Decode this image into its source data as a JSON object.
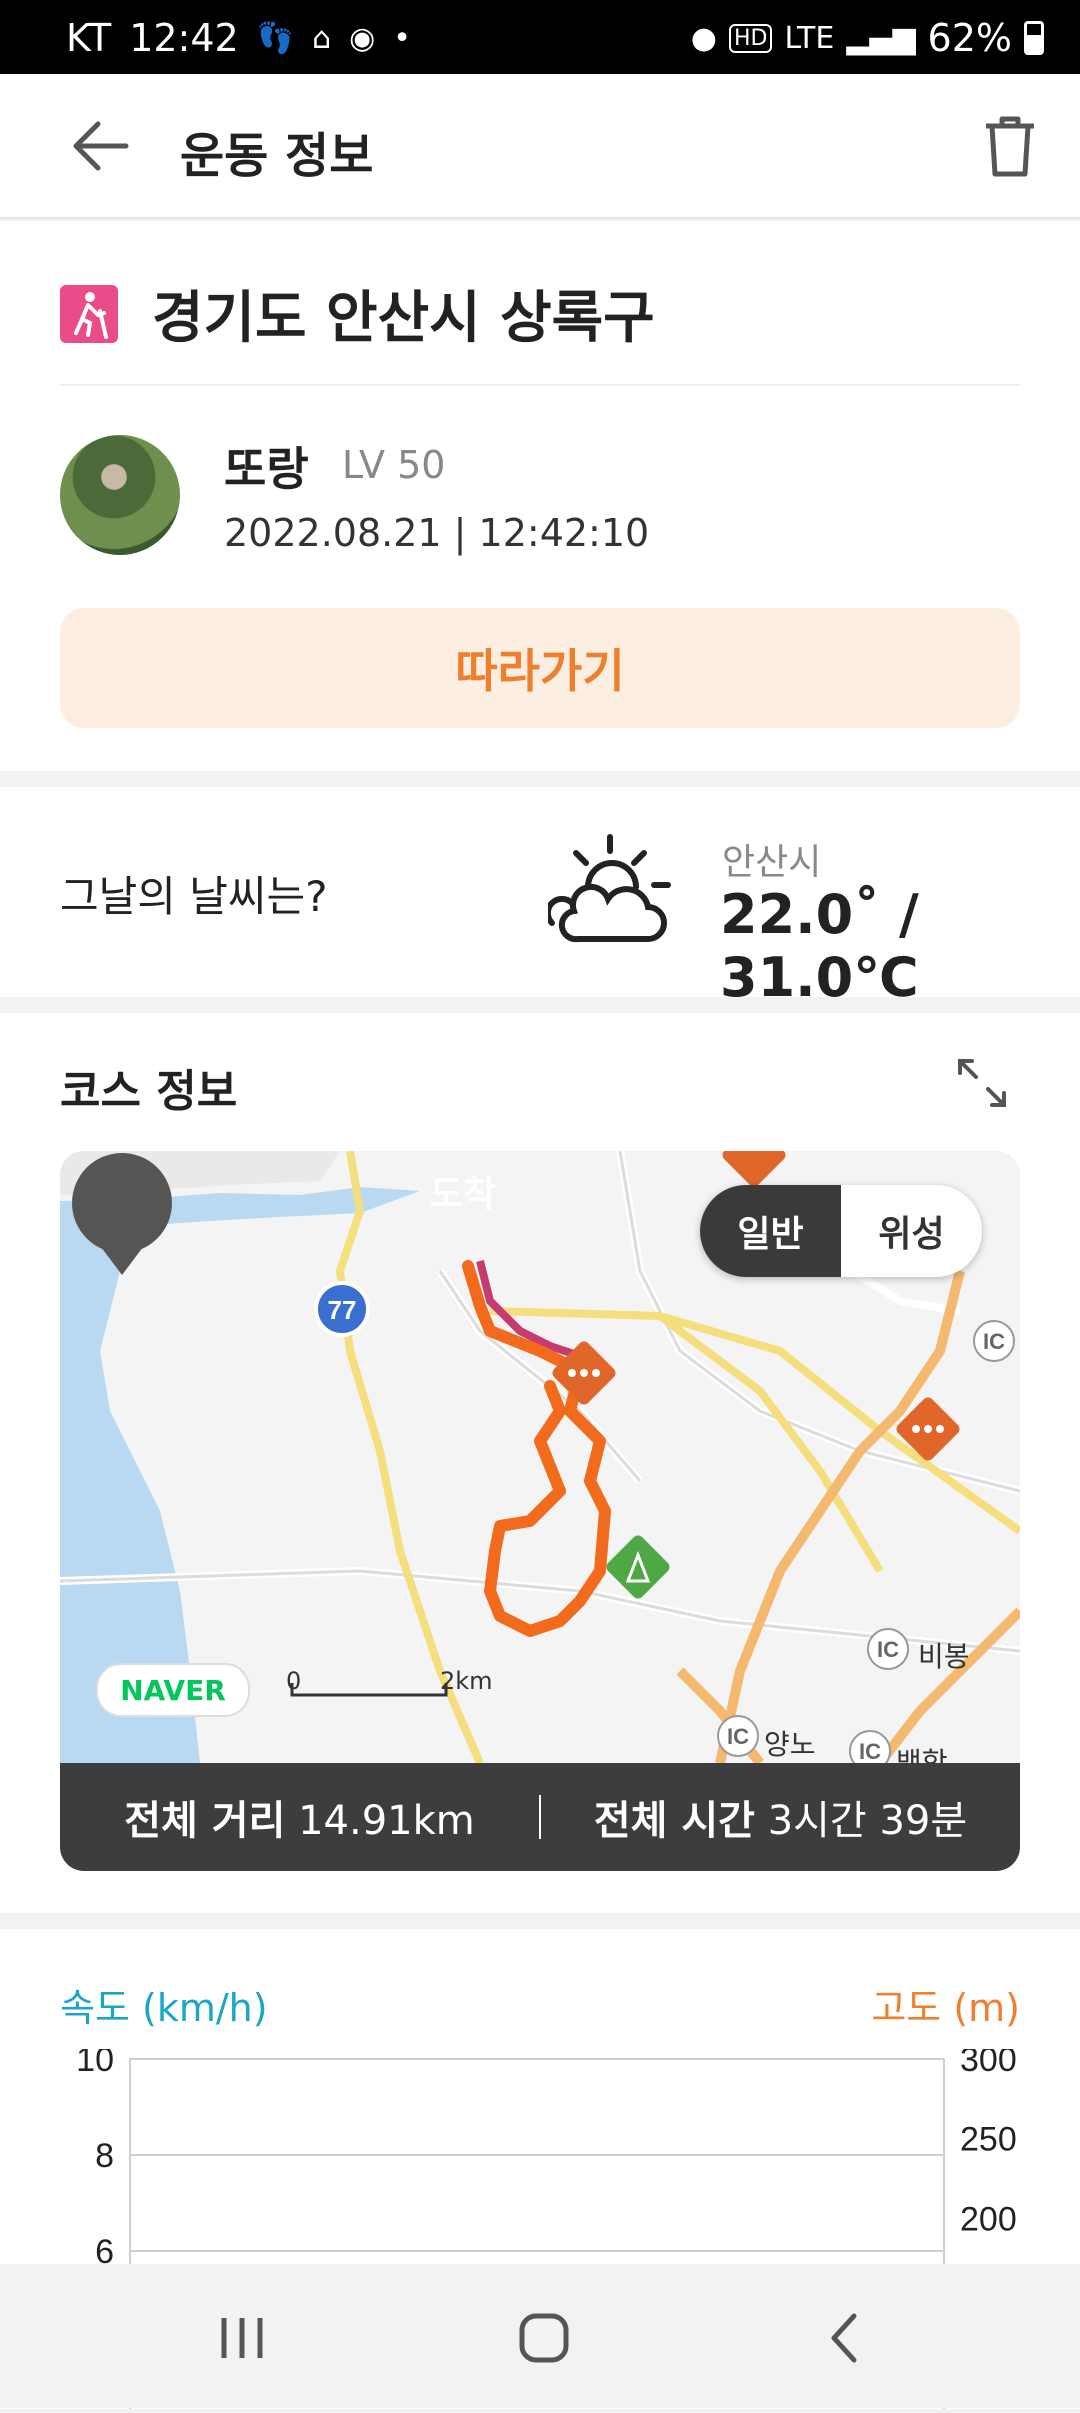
{
  "status_bar": {
    "carrier": "KT",
    "time": "12:42",
    "network": "LTE",
    "battery": "62%"
  },
  "header": {
    "title": "운동 정보"
  },
  "activity": {
    "location": "경기도 안산시 상록구",
    "user_name": "또랑",
    "level": "LV 50",
    "datetime": "2022.08.21 | 12:42:10",
    "follow_label": "따라가기"
  },
  "weather": {
    "question": "그날의 날씨는?",
    "city": "안산시",
    "temperature": "22.0˚ / 31.0℃"
  },
  "course": {
    "title": "코스 정보",
    "map": {
      "toggle_normal": "일반",
      "toggle_satellite": "위성",
      "arrive_label": "도착",
      "route_number": "77",
      "naver_label": "NAVER",
      "scale_start": "0",
      "scale_end": "2km",
      "place_labels": [
        "비봉",
        "양노",
        "백학"
      ],
      "ic_label": "IC"
    },
    "stats": {
      "distance_label": "전체 거리",
      "distance_value": "14.91km",
      "time_label": "전체 시간",
      "time_value": "3시간 39분"
    }
  },
  "chart": {
    "speed_label": "속도 (km/h)",
    "altitude_label": "고도 (m)"
  },
  "chart_data": {
    "type": "line",
    "ylabel": "속도 (km/h)",
    "y2label": "고도 (m)",
    "y_ticks": [
      "10",
      "8",
      "6"
    ],
    "y2_ticks": [
      "300",
      "250",
      "200"
    ],
    "ylim": [
      6,
      10
    ],
    "y2lim": [
      200,
      300
    ],
    "series": []
  },
  "colors": {
    "accent": "#f07f2d",
    "speed": "#1aa7c7",
    "route": "#f26b1d"
  }
}
